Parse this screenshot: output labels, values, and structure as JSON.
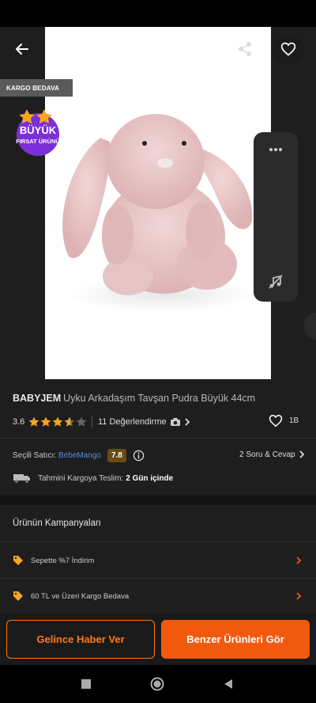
{
  "badges": {
    "free_shipping": "KARGO BEDAVA",
    "big_deal_line1": "BÜYÜK",
    "big_deal_line2": "FIRSAT ÜRÜNÜ"
  },
  "product": {
    "brand": "BABYJEM",
    "name": "Uyku Arkadaşım Tavşan Pudra Büyük 44cm",
    "rating": "3.6",
    "rating_value": 3.6,
    "review_count": "11 Değerlendirme",
    "likes": "1B"
  },
  "seller": {
    "label": "Seçili Satıcı:",
    "name": "BebeMango",
    "score": "7.8"
  },
  "qa": {
    "label": "2 Soru & Cevap"
  },
  "shipping": {
    "label": "Tahmini Kargoya Teslim:",
    "value": "2 Gün içinde"
  },
  "campaigns": {
    "title": "Ürünün Kampanyaları",
    "items": [
      {
        "label": "Sepette %7 İndirim"
      },
      {
        "label": "60 TL ve Üzeri Kargo Bedava"
      }
    ]
  },
  "actions": {
    "notify": "Gelince Haber Ver",
    "similar": "Benzer Ürünleri Gör"
  },
  "colors": {
    "accent": "#f15a0e",
    "star": "#f5a623",
    "link": "#4a90e2",
    "score_bg": "#6b4a14"
  },
  "icons": [
    "back-arrow-icon",
    "share-icon",
    "heart-icon",
    "more-icon",
    "music-off-icon",
    "star-icon",
    "camera-icon",
    "info-icon",
    "truck-icon",
    "tag-icon",
    "chevron-right-icon"
  ]
}
